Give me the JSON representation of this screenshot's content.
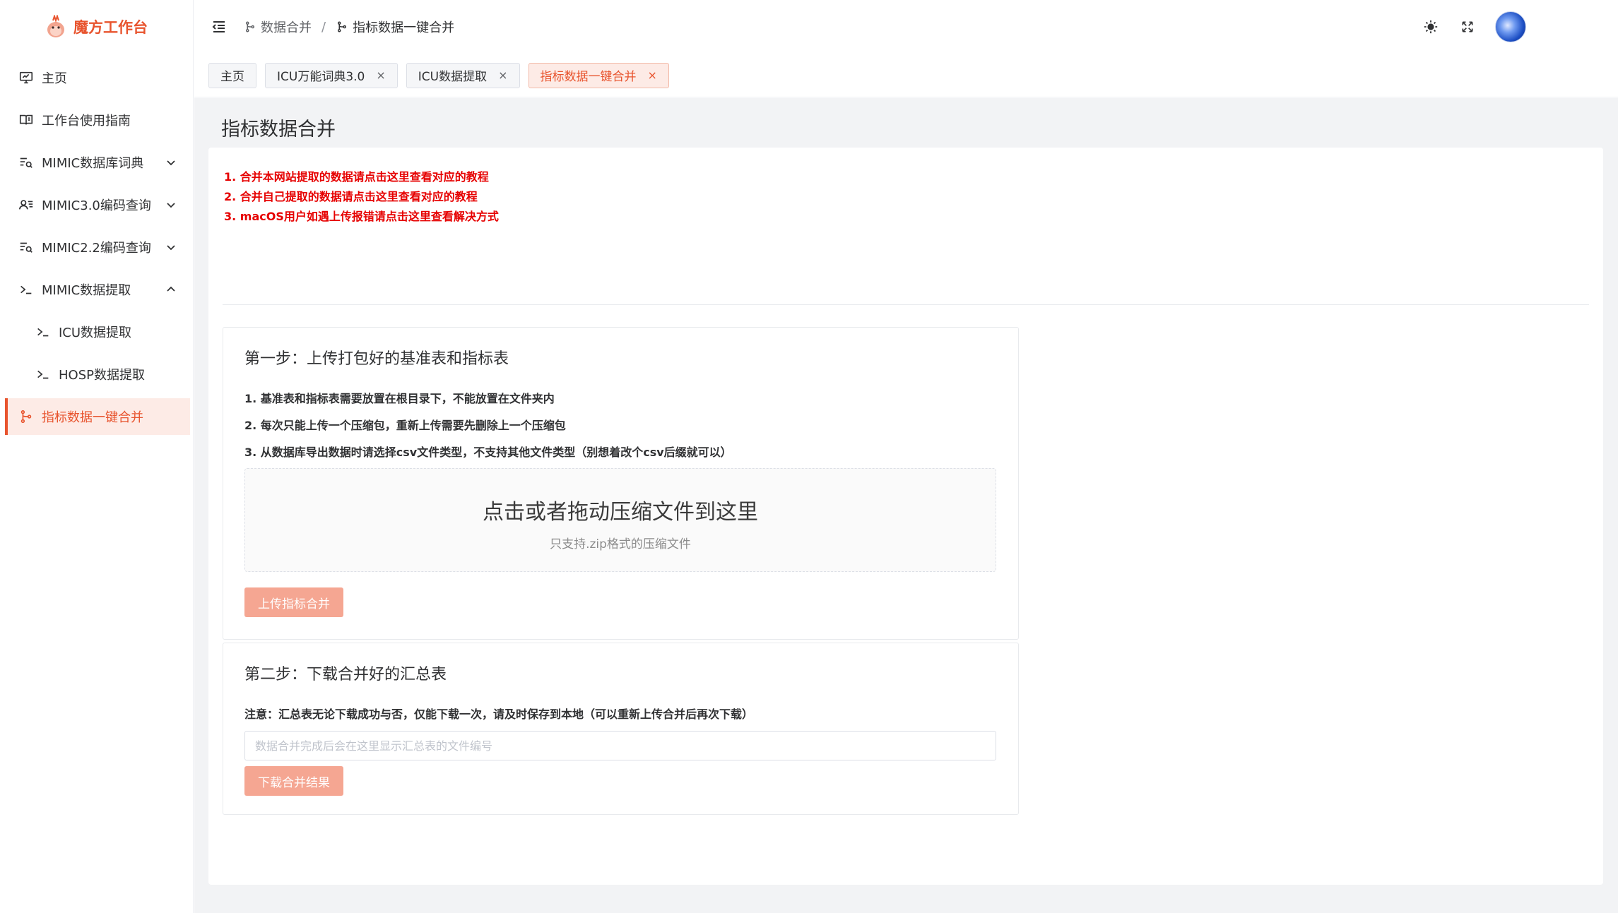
{
  "app": {
    "title": "魔方工作台",
    "accent_color": "#e8542e"
  },
  "sidebar": {
    "items": [
      {
        "label": "主页",
        "icon": "monitor-icon"
      },
      {
        "label": "工作台使用指南",
        "icon": "book-icon"
      },
      {
        "label": "MIMIC数据库词典",
        "icon": "list-search-icon",
        "expanded": false
      },
      {
        "label": "MIMIC3.0编码查询",
        "icon": "user-list-icon",
        "expanded": false
      },
      {
        "label": "MIMIC2.2编码查询",
        "icon": "list-search-icon",
        "expanded": false
      },
      {
        "label": "MIMIC数据提取",
        "icon": "terminal-icon",
        "expanded": true
      },
      {
        "label": "ICU数据提取",
        "icon": "terminal-icon"
      },
      {
        "label": "HOSP数据提取",
        "icon": "terminal-icon"
      },
      {
        "label": "指标数据一键合并",
        "icon": "branch-icon",
        "active": true
      }
    ]
  },
  "header": {
    "breadcrumb": [
      "数据合并",
      "指标数据一键合并"
    ],
    "breadcrumb_separator": "/"
  },
  "tabs": [
    {
      "label": "主页",
      "closable": false
    },
    {
      "label": "ICU万能词典3.0",
      "closable": true
    },
    {
      "label": "ICU数据提取",
      "closable": true
    },
    {
      "label": "指标数据一键合并",
      "closable": true,
      "active": true
    }
  ],
  "close_glyph": "×",
  "page": {
    "title": "指标数据合并",
    "notes": [
      "1. 合并本网站提取的数据请点击这里查看对应的教程",
      "2. 合并自己提取的数据请点击这里查看对应的教程",
      "3. macOS用户如遇上传报错请点击这里查看解决方式"
    ],
    "step1": {
      "title": "第一步：上传打包好的基准表和指标表",
      "rules": [
        "1. 基准表和指标表需要放置在根目录下，不能放置在文件夹内",
        "2. 每次只能上传一个压缩包，重新上传需要先删除上一个压缩包",
        "3. 从数据库导出数据时请选择csv文件类型，不支持其他文件类型（别想着改个csv后缀就可以）"
      ],
      "dropzone_main": "点击或者拖动压缩文件到这里",
      "dropzone_sub": "只支持.zip格式的压缩文件",
      "button": "上传指标合并"
    },
    "step2": {
      "title": "第二步：下载合并好的汇总表",
      "notice": "注意：汇总表无论下载成功与否，仅能下载一次，请及时保存到本地（可以重新上传合并后再次下载）",
      "input_placeholder": "数据合并完成后会在这里显示汇总表的文件编号",
      "input_value": "",
      "button": "下载合并结果"
    }
  }
}
